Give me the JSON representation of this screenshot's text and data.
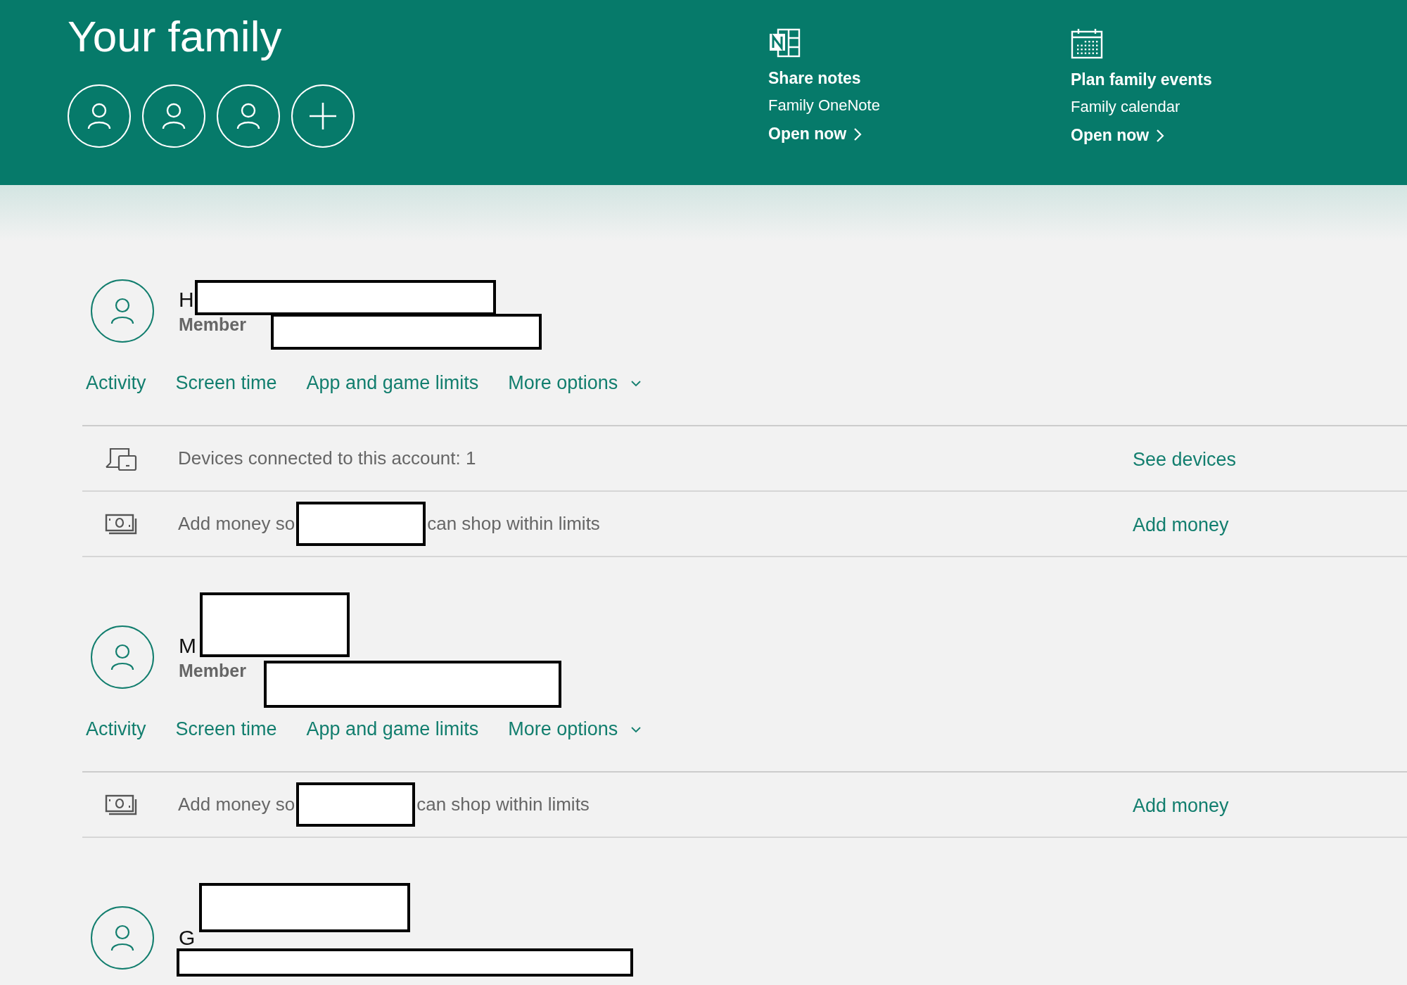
{
  "header": {
    "title": "Your family",
    "member_buttons": [
      {
        "kind": "person"
      },
      {
        "kind": "person"
      },
      {
        "kind": "person"
      },
      {
        "kind": "add"
      }
    ],
    "features": [
      {
        "kind": "notes",
        "title": "Share notes",
        "subtitle": "Family OneNote",
        "link": "Open now"
      },
      {
        "kind": "calendar",
        "title": "Plan family events",
        "subtitle": "Family calendar",
        "link": "Open now"
      }
    ]
  },
  "members": [
    {
      "name": "H",
      "role": "Member",
      "redacted": true,
      "links": [
        "Activity",
        "Screen time",
        "App and game limits",
        "More options"
      ],
      "rows": [
        {
          "kind": "devices",
          "text": "Devices connected to this account: 1",
          "action": "See devices"
        },
        {
          "kind": "money",
          "text_before": "Add money so",
          "text_after": "can shop within limits",
          "action": "Add money"
        }
      ]
    },
    {
      "name": "M",
      "role": "Member",
      "redacted": true,
      "links": [
        "Activity",
        "Screen time",
        "App and game limits",
        "More options"
      ],
      "rows": [
        {
          "kind": "money",
          "text_before": "Add money so",
          "text_after": "can shop within limits",
          "action": "Add money"
        }
      ]
    },
    {
      "name": "G",
      "redacted": true
    }
  ]
}
